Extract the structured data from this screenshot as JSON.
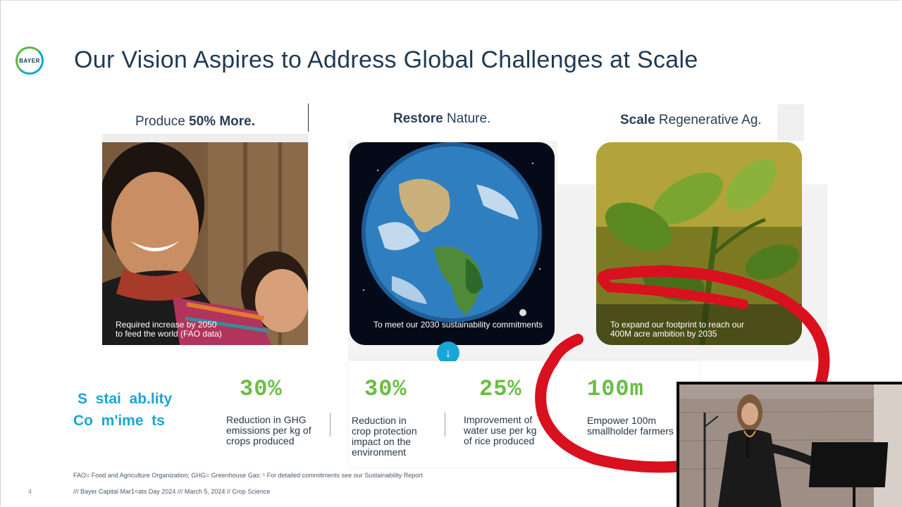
{
  "slide": {
    "title": "Our Vision Aspires to Address Global Challenges at Scale",
    "logo_text": "BAYER",
    "columns": [
      {
        "head_plain": "Produce ",
        "head_bold": "50% More.",
        "caption_line1": "Required increase by 2050",
        "caption_line2": "to feed the world (FAO data)"
      },
      {
        "head_bold": "Restore",
        "head_plain": " Nature.",
        "caption": "To meet our 2030 sustainability commitments"
      },
      {
        "head_bold": "Scale",
        "head_plain": " Regenerative Ag.",
        "caption_line1": "To expand our footprint to reach our",
        "caption_line2": "400M acre ambition by 2035"
      }
    ],
    "sustainability_label_line1": "S  stai  ab.lity",
    "sustainability_label_line2": "Co  m'ime  ts",
    "stats": [
      {
        "value": "30%",
        "line1": "Reduction in GHG",
        "line2": "emissions per kg of",
        "line3": "crops produced"
      },
      {
        "value": "30%",
        "line1": "Reduction in",
        "line2": "crop protection",
        "line3": "impact on the",
        "line4": "environment"
      },
      {
        "value": "25%",
        "line1": "Improvement of",
        "line2": "water use per kg",
        "line3": "of rice produced"
      },
      {
        "value": "100m",
        "line1": "Empower 100m",
        "line2": "smallholder farmers"
      }
    ],
    "footnote": "FAO= Food and Agriculture Organization; GHG= Greenhouse Gas: ¹ For detailed commitments see our Sustainability Report",
    "page_number": "4",
    "footer": "/// Bayer Capital Mar1<ats Day 2024 /// March 5, 2024 // Crop Science"
  },
  "colors": {
    "accent_green": "#6bbd45",
    "accent_blue": "#19a6d6",
    "annotation_red": "#d9101e",
    "title": "#1f3a52"
  }
}
